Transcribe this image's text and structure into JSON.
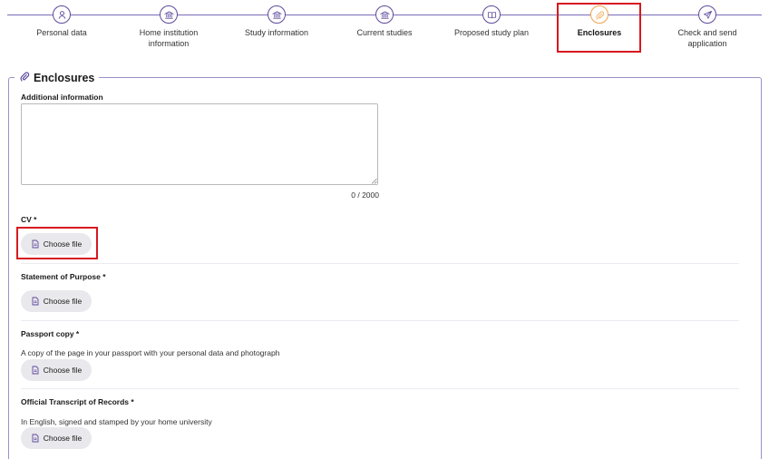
{
  "stepper": {
    "steps": [
      {
        "label": "Personal data",
        "icon": "person-icon"
      },
      {
        "label": "Home institution\ninformation",
        "icon": "institution-icon"
      },
      {
        "label": "Study information",
        "icon": "institution-icon"
      },
      {
        "label": "Current studies",
        "icon": "institution-icon"
      },
      {
        "label": "Proposed study plan",
        "icon": "book-icon"
      },
      {
        "label": "Enclosures",
        "icon": "paperclip-icon"
      },
      {
        "label": "Check and send\napplication",
        "icon": "send-icon"
      }
    ],
    "active_index": 5,
    "accent_color": "#5d4a9c",
    "active_color": "#f0a24a"
  },
  "section": {
    "title": "Enclosures",
    "icon": "paperclip-icon"
  },
  "additional_info": {
    "label": "Additional information",
    "value": "",
    "counter": "0 / 2000"
  },
  "uploads": [
    {
      "label": "CV *",
      "hint": "",
      "button": "Choose file"
    },
    {
      "label": "Statement of Purpose *",
      "hint": "",
      "button": "Choose file"
    },
    {
      "label": "Passport copy *",
      "hint": "A copy of the page in your passport with your personal data and photograph",
      "button": "Choose file"
    },
    {
      "label": "Official Transcript of Records *",
      "hint": "In English, signed and stamped by your home university",
      "button": "Choose file"
    }
  ],
  "highlight_color": "#d7191f"
}
